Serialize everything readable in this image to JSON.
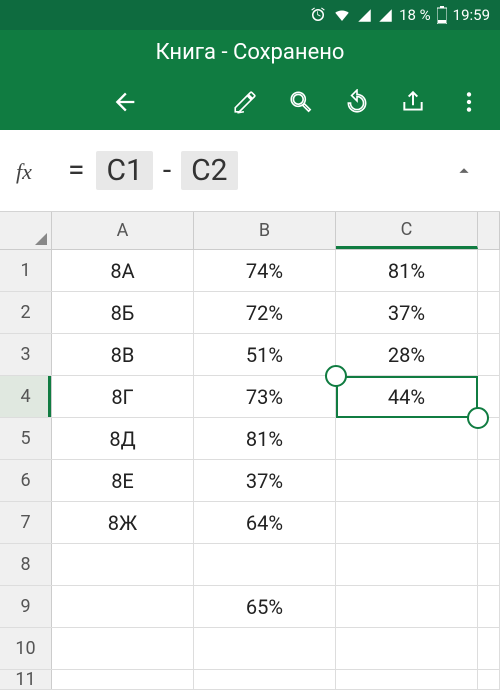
{
  "status": {
    "battery_percent": "18 %",
    "time": "19:59"
  },
  "title": "Книга - Сохранено",
  "formula": {
    "fx": "fx",
    "eq": "=",
    "ref1": "C1",
    "op": "-",
    "ref2": "C2"
  },
  "columns": [
    "A",
    "B",
    "C"
  ],
  "rows": [
    {
      "n": "1",
      "a": "8А",
      "b": "74%",
      "c": "81%"
    },
    {
      "n": "2",
      "a": "8Б",
      "b": "72%",
      "c": "37%"
    },
    {
      "n": "3",
      "a": "8В",
      "b": "51%",
      "c": "28%"
    },
    {
      "n": "4",
      "a": "8Г",
      "b": "73%",
      "c": "44%"
    },
    {
      "n": "5",
      "a": "8Д",
      "b": "81%",
      "c": ""
    },
    {
      "n": "6",
      "a": "8Е",
      "b": "37%",
      "c": ""
    },
    {
      "n": "7",
      "a": "8Ж",
      "b": "64%",
      "c": ""
    },
    {
      "n": "8",
      "a": "",
      "b": "",
      "c": ""
    },
    {
      "n": "9",
      "a": "",
      "b": "65%",
      "c": ""
    },
    {
      "n": "10",
      "a": "",
      "b": "",
      "c": ""
    },
    {
      "n": "11",
      "a": "",
      "b": "",
      "c": ""
    }
  ],
  "selected_row": 3,
  "selected_col": 2
}
